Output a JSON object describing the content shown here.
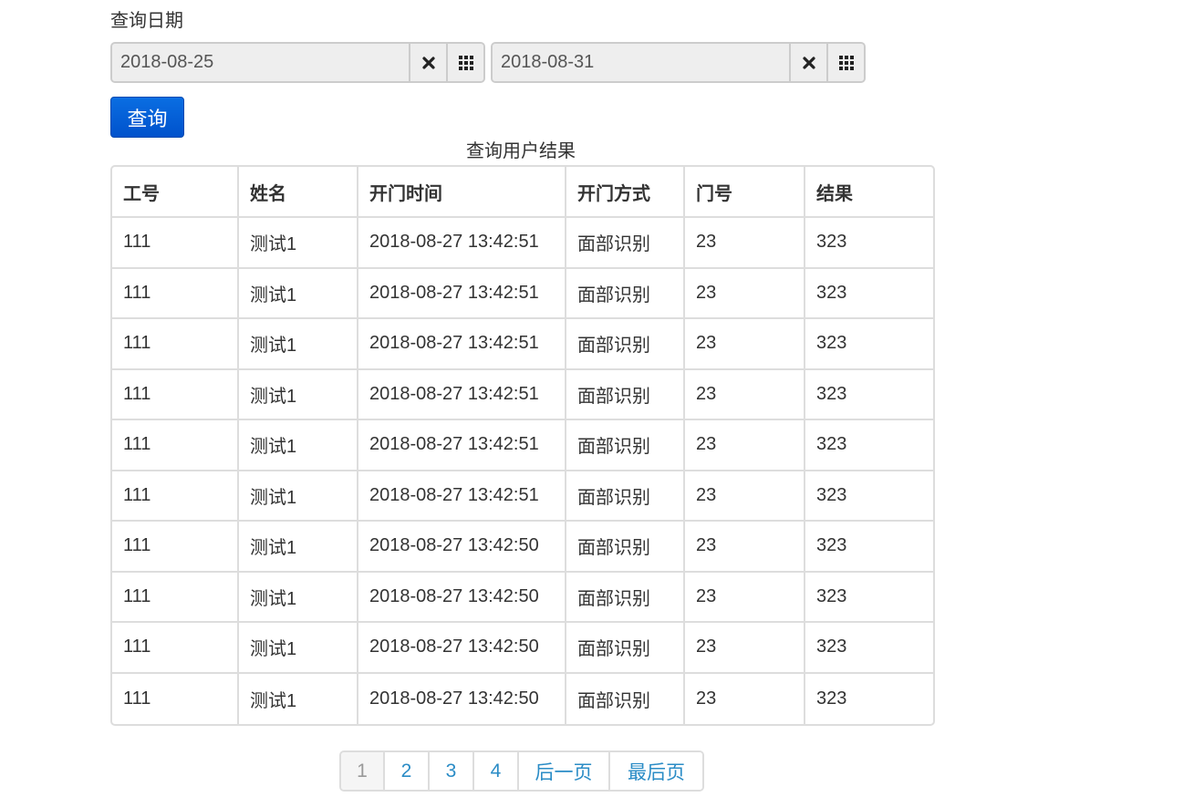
{
  "form": {
    "date_label": "查询日期",
    "start_date": "2018-08-25",
    "end_date": "2018-08-31",
    "query_button": "查询",
    "clear_icon": "close-icon",
    "calendar_icon": "calendar-grid-icon"
  },
  "table": {
    "caption": "查询用户结果",
    "headers": [
      "工号",
      "姓名",
      "开门时间",
      "开门方式",
      "门号",
      "结果"
    ],
    "rows": [
      [
        "111",
        "测试1",
        "2018-08-27 13:42:51",
        "面部识别",
        "23",
        "323"
      ],
      [
        "111",
        "测试1",
        "2018-08-27 13:42:51",
        "面部识别",
        "23",
        "323"
      ],
      [
        "111",
        "测试1",
        "2018-08-27 13:42:51",
        "面部识别",
        "23",
        "323"
      ],
      [
        "111",
        "测试1",
        "2018-08-27 13:42:51",
        "面部识别",
        "23",
        "323"
      ],
      [
        "111",
        "测试1",
        "2018-08-27 13:42:51",
        "面部识别",
        "23",
        "323"
      ],
      [
        "111",
        "测试1",
        "2018-08-27 13:42:51",
        "面部识别",
        "23",
        "323"
      ],
      [
        "111",
        "测试1",
        "2018-08-27 13:42:50",
        "面部识别",
        "23",
        "323"
      ],
      [
        "111",
        "测试1",
        "2018-08-27 13:42:50",
        "面部识别",
        "23",
        "323"
      ],
      [
        "111",
        "测试1",
        "2018-08-27 13:42:50",
        "面部识别",
        "23",
        "323"
      ],
      [
        "111",
        "测试1",
        "2018-08-27 13:42:50",
        "面部识别",
        "23",
        "323"
      ]
    ]
  },
  "pagination": {
    "items": [
      {
        "label": "1",
        "active": true
      },
      {
        "label": "2",
        "active": false
      },
      {
        "label": "3",
        "active": false
      },
      {
        "label": "4",
        "active": false
      },
      {
        "label": "后一页",
        "active": false
      },
      {
        "label": "最后页",
        "active": false
      }
    ]
  },
  "colors": {
    "primary_button": "#0052cc",
    "link": "#2a8cc6",
    "border": "#dddddd",
    "input_bg": "#eeeeee"
  }
}
